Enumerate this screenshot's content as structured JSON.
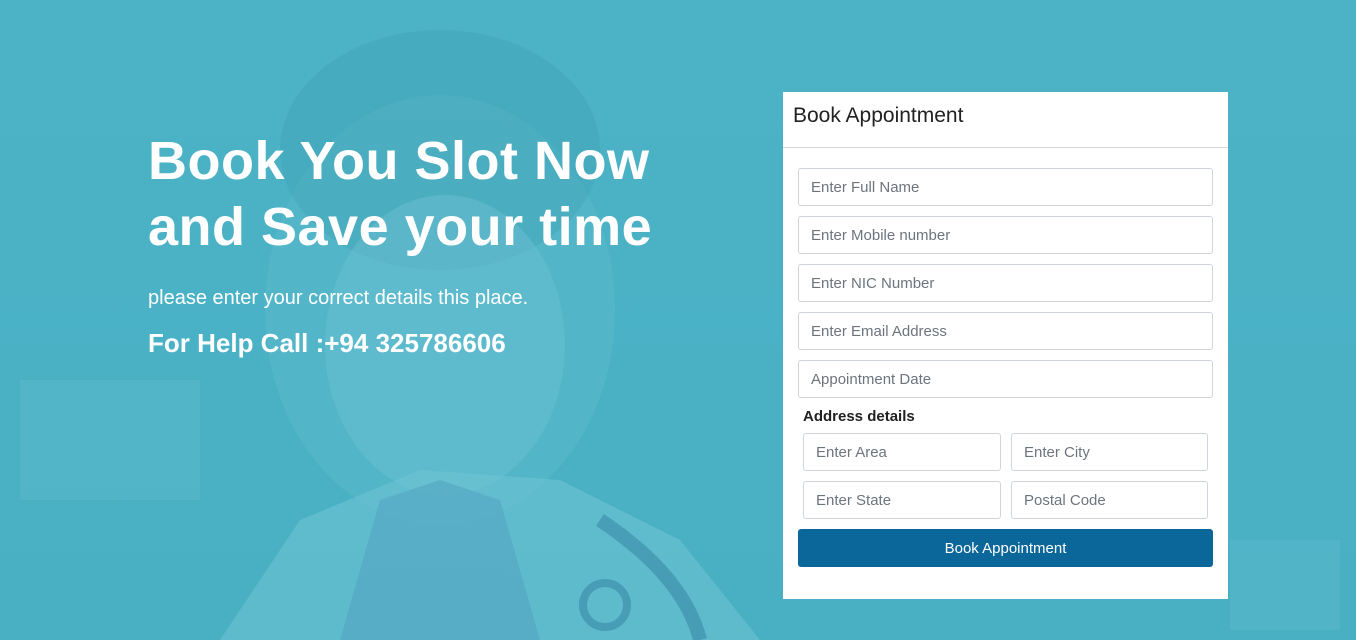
{
  "hero": {
    "title_line1": "Book You Slot Now",
    "title_line2": "and Save your time",
    "subtitle": "please enter your correct details this place.",
    "help": "For Help Call :+94 325786606"
  },
  "form": {
    "title": "Book Appointment",
    "full_name_placeholder": "Enter Full Name",
    "mobile_placeholder": "Enter Mobile number",
    "nic_placeholder": "Enter NIC Number",
    "email_placeholder": "Enter Email Address",
    "date_placeholder": "Appointment Date",
    "address_label": "Address details",
    "area_placeholder": "Enter Area",
    "city_placeholder": "Enter City",
    "state_placeholder": "Enter State",
    "postal_placeholder": "Postal Code",
    "submit_label": "Book Appointment"
  },
  "colors": {
    "background": "#4ab2c6",
    "button": "#0b6699",
    "text_light": "#ffffff"
  }
}
